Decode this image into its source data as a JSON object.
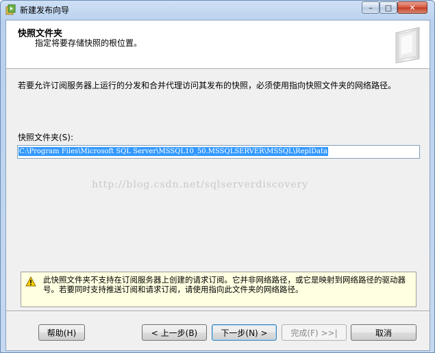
{
  "window": {
    "title": "新建发布向导",
    "controls": {
      "minimize": "–",
      "maximize": "□",
      "close": "✕"
    }
  },
  "header": {
    "title": "快照文件夹",
    "subtitle": "指定将要存储快照的根位置。"
  },
  "body": {
    "description": "若要允许订阅服务器上运行的分发和合并代理访问其发布的快照，必须使用指向快照文件夹的网络路径。",
    "folder_label": "快照文件夹(S):",
    "folder_value": "C:\\Program Files\\Microsoft SQL Server\\MSSQL10_50.MSSQLSERVER\\MSSQL\\ReplData",
    "watermark": "http://blog.csdn.net/sqlserverdiscovery"
  },
  "warning": {
    "icon": "warning-triangle-icon",
    "text": "此快照文件夹不支持在订阅服务器上创建的请求订阅。它并非网络路径，或它是映射到网络路径的驱动器号。若要同时支持推送订阅和请求订阅，请使用指向此文件夹的网络路径。"
  },
  "buttons": {
    "help": "帮助(H)",
    "back": "< 上一步(B)",
    "next": "下一步(N) >",
    "finish": "完成(F) >>|",
    "cancel": "取消"
  },
  "colors": {
    "title_gradient": "#c4d9f1",
    "selection": "#3399ff",
    "warning_bg": "#ffffe1",
    "close_button": "#c23b23"
  }
}
